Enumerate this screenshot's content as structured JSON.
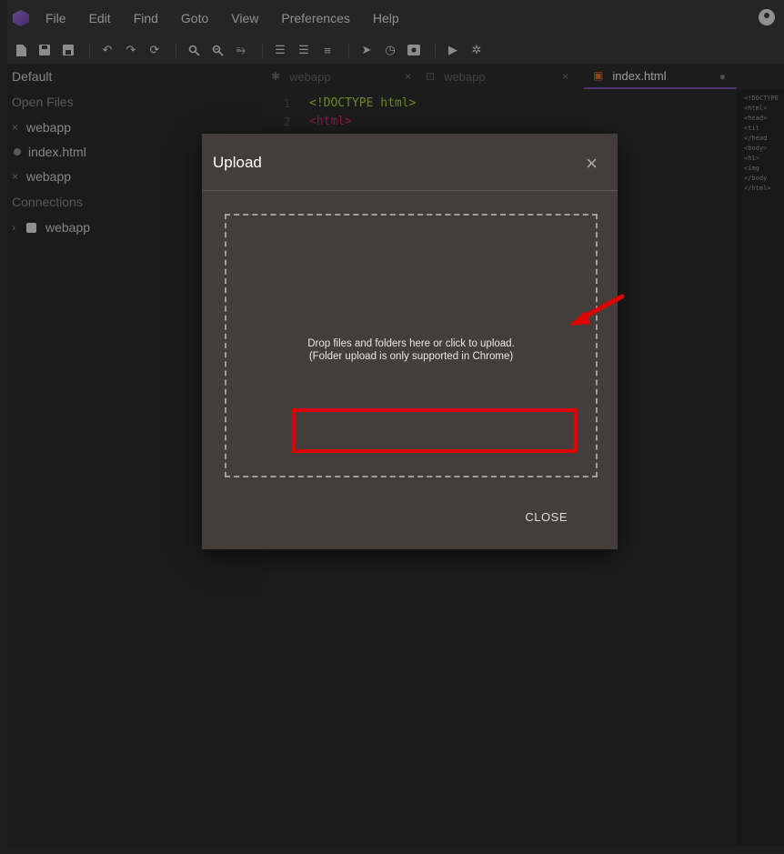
{
  "menubar": {
    "items": [
      "File",
      "Edit",
      "Find",
      "Goto",
      "View",
      "Preferences",
      "Help"
    ]
  },
  "toolbar": {
    "icons": [
      "new-file-icon",
      "save-icon",
      "save-all-icon",
      "undo-icon",
      "redo-icon",
      "refresh-icon",
      "search-icon",
      "replace-icon",
      "wrap-icon",
      "indent-icon",
      "outdent-icon",
      "format-icon",
      "send-icon",
      "history-icon",
      "preview-icon",
      "run-icon",
      "settings-icon"
    ]
  },
  "tabs": {
    "project": "Default",
    "items": [
      {
        "label": "webapp",
        "close": "×"
      },
      {
        "label": "webapp",
        "close": "×"
      },
      {
        "label": "index.html",
        "close": "●"
      }
    ]
  },
  "sidebar": {
    "open_files_header": "Open Files",
    "open_files": [
      {
        "label": "webapp",
        "mark": "×"
      },
      {
        "label": "index.html",
        "mark": ""
      },
      {
        "label": "webapp",
        "mark": "×"
      }
    ],
    "connections_header": "Connections",
    "connections": [
      {
        "label": "webapp",
        "mark": "›"
      }
    ]
  },
  "editor": {
    "lines": [
      {
        "num": "1",
        "text": "<!DOCTYPE html>",
        "color": "#a6d13a"
      },
      {
        "num": "2",
        "text": "<html>",
        "color": "#e0226e"
      }
    ]
  },
  "minimap": {
    "lines": [
      "<!DOCTYPE",
      "<html>",
      "  <head>",
      "    <tit",
      "  </head",
      "  <body>",
      "    <h1>",
      "    <img",
      "  </body",
      "</html>"
    ]
  },
  "dialog": {
    "title": "Upload",
    "close_icon": "×",
    "drop_line1": "Drop files and folders here or click to upload.",
    "drop_line2": "(Folder upload is only supported in Chrome)",
    "close_button": "CLOSE"
  },
  "colors": {
    "accent": "#7c4fb3",
    "highlight": "#e00000",
    "dialog_bg": "#433d3c"
  }
}
